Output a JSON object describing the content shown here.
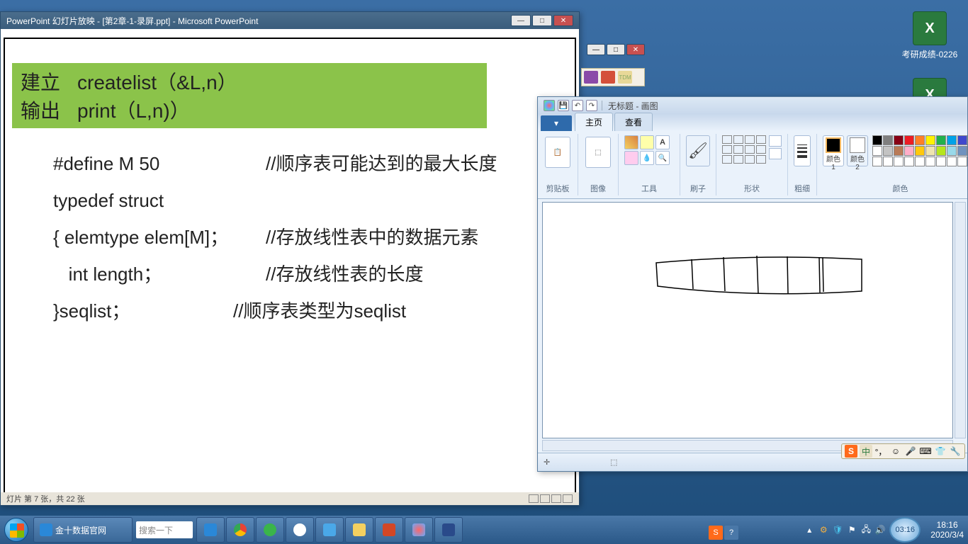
{
  "desktop": {
    "icon1_label": "考研成绩-0226",
    "icon2_label": ""
  },
  "powerpoint": {
    "title": "PowerPoint 幻灯片放映 - [第2章-1-录屏.ppt] - Microsoft PowerPoint",
    "status": "灯片 第 7 张，共 22 张",
    "green": {
      "r1a": "建立",
      "r1b": "createlist（&L,n）",
      "r2a": "输出",
      "r2b": "print（L,n)）"
    },
    "code": {
      "l1a": "#define M  50",
      "l1b": "//顺序表可能达到的最大长度",
      "l2a": "typedef struct",
      "l2b": "",
      "l3a": "{  elemtype elem[M]；",
      "l3b": "//存放线性表中的数据元素",
      "l4a": "   int length；",
      "l4b": "//存放线性表的长度",
      "l5a": "}seqlist；",
      "l5b": "//顺序表类型为seqlist"
    }
  },
  "paint": {
    "title_doc": "无标题 - 画图",
    "tabs": {
      "home": "主页",
      "view": "查看"
    },
    "groups": {
      "clipboard": "剪贴板",
      "image": "图像",
      "tools": "工具",
      "brush": "刷子",
      "shapes": "形状",
      "size": "粗细",
      "color1": "颜色 1",
      "color2": "颜色 2",
      "colors": "颜色"
    }
  },
  "ime": {
    "s": "S",
    "zh": "中",
    "punct": "°，"
  },
  "taskbar": {
    "browser_title": "金十数据官网",
    "search_placeholder": "搜索一下",
    "clock_widget": "03:16",
    "time": "18:16",
    "date": "2020/3/4"
  },
  "palette_colors": [
    "#000000",
    "#7f7f7f",
    "#880015",
    "#ed1c24",
    "#ff7f27",
    "#fff200",
    "#22b14c",
    "#00a2e8",
    "#3f48cc",
    "#a349a4",
    "#ffffff",
    "#c3c3c3",
    "#b97a57",
    "#ffaec9",
    "#ffc90e",
    "#efe4b0",
    "#b5e61d",
    "#99d9ea",
    "#7092be",
    "#c8bfe7",
    "#ffffff",
    "#ffffff",
    "#ffffff",
    "#ffffff",
    "#ffffff",
    "#ffffff",
    "#ffffff",
    "#ffffff",
    "#ffffff",
    "#ffffff"
  ]
}
